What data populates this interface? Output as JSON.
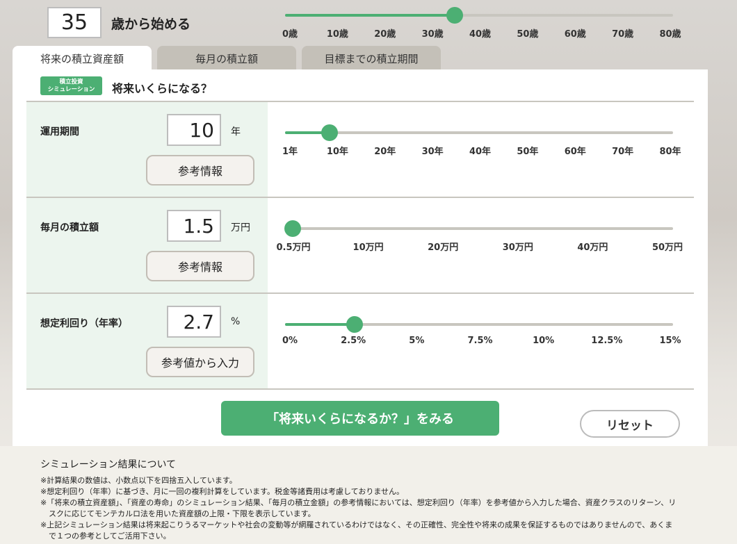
{
  "age": {
    "value": "35",
    "label": "歳から始める",
    "slider_value": 35,
    "slider_min": 0,
    "slider_max": 80,
    "ticks": [
      "0歳",
      "10歳",
      "20歳",
      "30歳",
      "40歳",
      "50歳",
      "60歳",
      "70歳",
      "80歳"
    ]
  },
  "tabs": [
    {
      "label": "将来の積立資産額",
      "active": true
    },
    {
      "label": "毎月の積立額",
      "active": false
    },
    {
      "label": "目標までの積立期間",
      "active": false
    }
  ],
  "panel": {
    "badge_line1": "積立投資",
    "badge_line2": "シミュレーション",
    "title": "将来いくらになる？"
  },
  "rows": [
    {
      "label": "運用期間",
      "value": "10",
      "unit": "年",
      "button": "参考情報",
      "slider_fraction": 0.1139,
      "ticks": [
        "1年",
        "10年",
        "20年",
        "30年",
        "40年",
        "50年",
        "60年",
        "70年",
        "80年"
      ]
    },
    {
      "label": "毎月の積立額",
      "value": "1.5",
      "unit": "万円",
      "button": "参考情報",
      "slider_fraction": 0.0202,
      "ticks": [
        "0.5万円",
        "10万円",
        "20万円",
        "30万円",
        "40万円",
        "50万円"
      ]
    },
    {
      "label": "想定利回り（年率）",
      "value": "2.7",
      "unit": "%",
      "button": "参考値から入力",
      "slider_fraction": 0.18,
      "ticks": [
        "0%",
        "2.5%",
        "5%",
        "7.5%",
        "10%",
        "12.5%",
        "15%"
      ]
    }
  ],
  "actions": {
    "submit": "「将来いくらになるか？」をみる",
    "reset": "リセット"
  },
  "notes": {
    "title": "シミュレーション結果について",
    "items": [
      "※計算結果の数値は、小数点以下を四捨五入しています。",
      "※想定利回り（年率）に基づき、月に一回の複利計算をしています。税金等諸費用は考慮しておりません。",
      "※「将来の積立資産額」、「資産の寿命」のシミュレーション結果、「毎月の積立金額」の参考情報においては、想定利回り（年率）を参考値から入力した場合、資産クラスのリターン、リスクに応じてモンテカルロ法を用いた資産額の上限・下限を表示しています。",
      "※上記シミュレーション結果は将来起こりうるマーケットや社会の変動等が網羅されているわけではなく、その正確性、完全性や将来の成果を保証するものではありませんので、あくまで１つの参考としてご活用下さい。"
    ]
  },
  "colors": {
    "accent": "#4caf73",
    "track": "#c8c6bf",
    "row_bg": "#ecf5ee"
  }
}
